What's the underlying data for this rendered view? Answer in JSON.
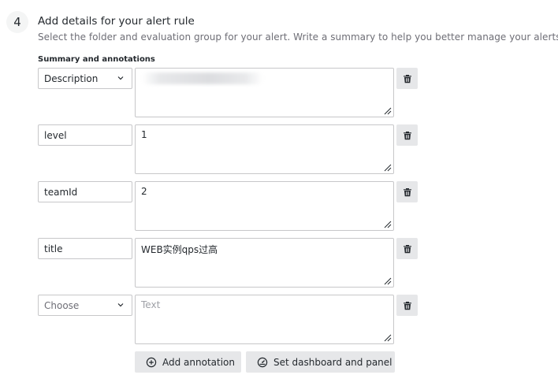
{
  "step": {
    "number": "4",
    "title": "Add details for your alert rule",
    "description": "Select the folder and evaluation group for your alert. Write a summary to help you better manage your alerts"
  },
  "annotations": {
    "section_label": "Summary and annotations",
    "rows": [
      {
        "key": "Description",
        "key_type": "select",
        "value": "",
        "value_blurred": true
      },
      {
        "key": "level",
        "key_type": "input",
        "value": "1"
      },
      {
        "key": "teamId",
        "key_type": "input",
        "value": "2"
      },
      {
        "key": "title",
        "key_type": "input",
        "value": "WEB实例qps过高"
      },
      {
        "key": "Choose",
        "key_type": "select-placeholder",
        "value": "",
        "value_placeholder": "Text"
      }
    ]
  },
  "buttons": {
    "add_annotation": "Add annotation",
    "set_dashboard": "Set dashboard and panel"
  },
  "icons": {
    "delete": "trash-icon",
    "add": "plus-circle-icon",
    "dashboard": "dashboard-gauge-icon",
    "dropdown": "chevron-down-icon",
    "resize": "resize-handle-icon"
  }
}
